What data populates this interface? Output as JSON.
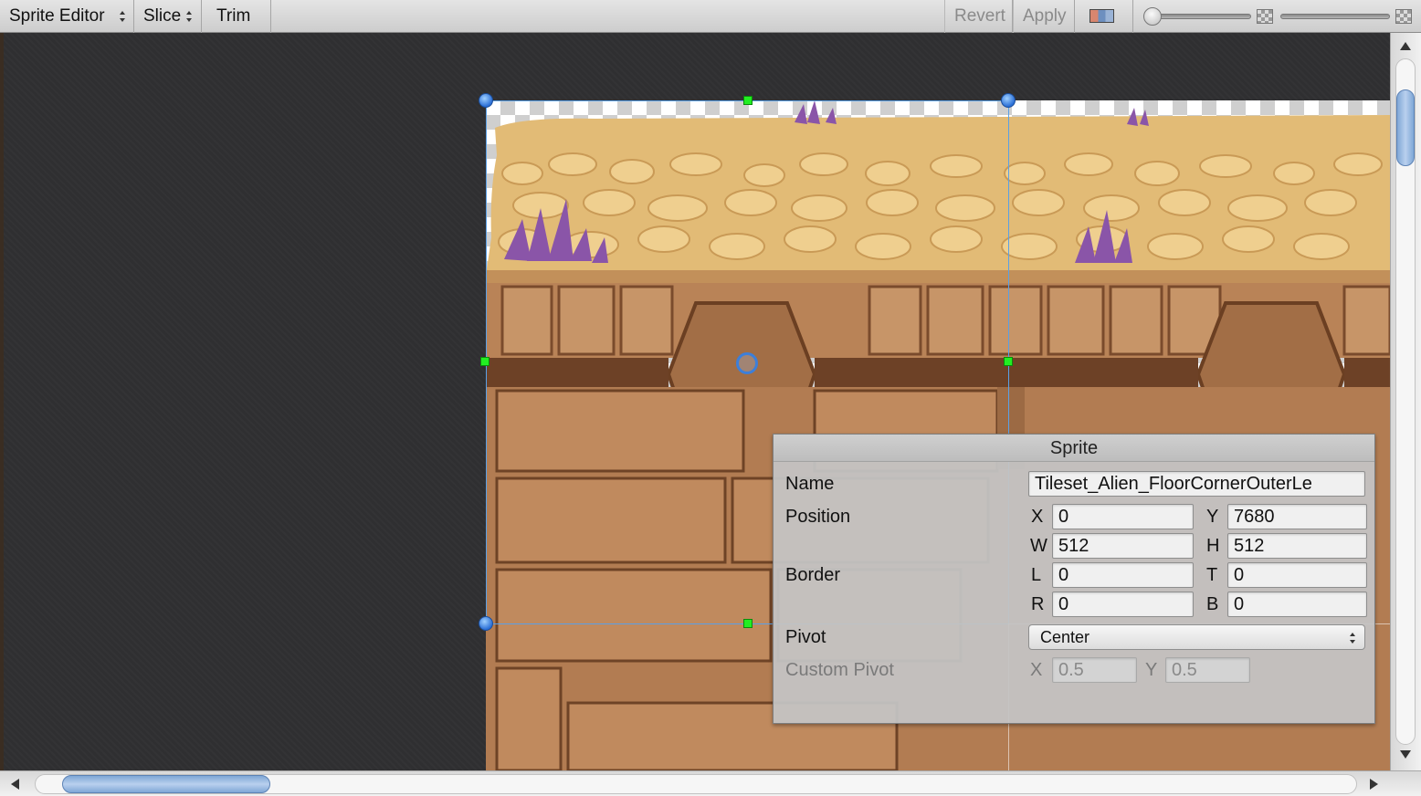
{
  "toolbar": {
    "sprite_editor_label": "Sprite Editor",
    "slice_label": "Slice",
    "trim_label": "Trim",
    "revert_label": "Revert",
    "apply_label": "Apply",
    "color_toggle_icon": "rgb-alpha-toggle-icon",
    "zoom_slider_level": 0.02,
    "mip_slider_level": 0.0,
    "checker_icon": "checker-icon"
  },
  "panel": {
    "title": "Sprite",
    "name_label": "Name",
    "name_value": "Tileset_Alien_FloorCornerOuterLe",
    "position_label": "Position",
    "x_label": "X",
    "x_value": "0",
    "y_label": "Y",
    "y_value": "7680",
    "w_label": "W",
    "w_value": "512",
    "h_label": "H",
    "h_value": "512",
    "border_label": "Border",
    "l_label": "L",
    "l_value": "0",
    "t_label": "T",
    "t_value": "0",
    "r_label": "R",
    "r_value": "0",
    "b_label": "B",
    "b_value": "0",
    "pivot_label": "Pivot",
    "pivot_value": "Center",
    "custom_pivot_label": "Custom Pivot",
    "cx_label": "X",
    "cx_value": "0.5",
    "cy_label": "Y",
    "cy_value": "0.5"
  },
  "colors": {
    "selection": "#5aa0e6",
    "handle_green": "#22ee22",
    "handle_blue": "#2b6fd6",
    "stone_light": "#e6bf7a",
    "stone_dark": "#8a5a36",
    "crystal": "#8a55a8"
  }
}
